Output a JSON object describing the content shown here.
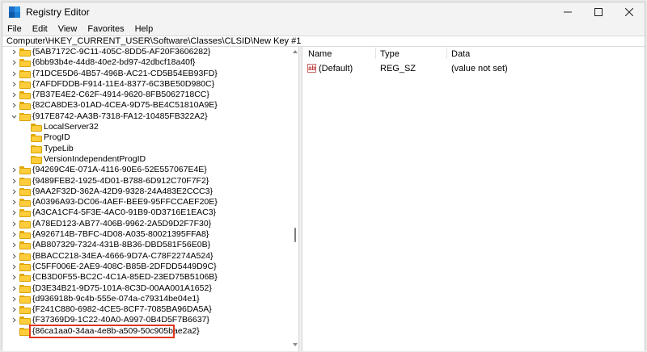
{
  "window": {
    "title": "Registry Editor",
    "controls": [
      "minimize-icon",
      "maximize-icon",
      "close-icon"
    ]
  },
  "menu": [
    "File",
    "Edit",
    "View",
    "Favorites",
    "Help"
  ],
  "address": "Computer\\HKEY_CURRENT_USER\\Software\\Classes\\CLSID\\New Key #1",
  "tree": [
    {
      "label": "{5AB7172C-9C11-405C-8DD5-AF20F3606282}",
      "level": 0,
      "expanded": false
    },
    {
      "label": "{6bb93b4e-44d8-40e2-bd97-42dbcf18a40f}",
      "level": 0,
      "expanded": false
    },
    {
      "label": "{71DCE5D6-4B57-496B-AC21-CD5B54EB93FD}",
      "level": 0,
      "expanded": false
    },
    {
      "label": "{7AFDFDDB-F914-11E4-8377-6C3BE50D980C}",
      "level": 0,
      "expanded": false
    },
    {
      "label": "{7B37E4E2-C62F-4914-9620-8FB5062718CC}",
      "level": 0,
      "expanded": false
    },
    {
      "label": "{82CA8DE3-01AD-4CEA-9D75-BE4C51810A9E}",
      "level": 0,
      "expanded": false
    },
    {
      "label": "{917E8742-AA3B-7318-FA12-10485FB322A2}",
      "level": 0,
      "expanded": true
    },
    {
      "label": "LocalServer32",
      "level": 1,
      "expanded": null
    },
    {
      "label": "ProgID",
      "level": 1,
      "expanded": null
    },
    {
      "label": "TypeLib",
      "level": 1,
      "expanded": null
    },
    {
      "label": "VersionIndependentProgID",
      "level": 1,
      "expanded": null
    },
    {
      "label": "{94269C4E-071A-4116-90E6-52E557067E4E}",
      "level": 0,
      "expanded": false
    },
    {
      "label": "{9489FEB2-1925-4D01-B788-6D912C70F7F2}",
      "level": 0,
      "expanded": false
    },
    {
      "label": "{9AA2F32D-362A-42D9-9328-24A483E2CCC3}",
      "level": 0,
      "expanded": false
    },
    {
      "label": "{A0396A93-DC06-4AEF-BEE9-95FFCCAEF20E}",
      "level": 0,
      "expanded": false
    },
    {
      "label": "{A3CA1CF4-5F3E-4AC0-91B9-0D3716E1EAC3}",
      "level": 0,
      "expanded": false
    },
    {
      "label": "{A78ED123-AB77-406B-9962-2A5D9D2F7F30}",
      "level": 0,
      "expanded": false
    },
    {
      "label": "{A926714B-7BFC-4D08-A035-80021395FFA8}",
      "level": 0,
      "expanded": false
    },
    {
      "label": "{AB807329-7324-431B-8B36-DBD581F56E0B}",
      "level": 0,
      "expanded": false
    },
    {
      "label": "{BBACC218-34EA-4666-9D7A-C78F2274A524}",
      "level": 0,
      "expanded": false
    },
    {
      "label": "{C5FF006E-2AE9-408C-B85B-2DFDD5449D9C}",
      "level": 0,
      "expanded": false
    },
    {
      "label": "{CB3D0F55-BC2C-4C1A-85ED-23ED75B5106B}",
      "level": 0,
      "expanded": false
    },
    {
      "label": "{D3E34B21-9D75-101A-8C3D-00AA001A1652}",
      "level": 0,
      "expanded": false
    },
    {
      "label": "{d936918b-9c4b-555e-074a-c79314be04e1}",
      "level": 0,
      "expanded": false
    },
    {
      "label": "{F241C880-6982-4CE5-8CF7-7085BA96DA5A}",
      "level": 0,
      "expanded": false
    },
    {
      "label": "{F37369D9-1C22-40A0-A997-0B4D5F7B6637}",
      "level": 0,
      "expanded": false
    },
    {
      "label": "{86ca1aa0-34aa-4e8b-a509-50c905bae2a2}",
      "level": 0,
      "expanded": null,
      "highlighted": true
    }
  ],
  "columns": {
    "name": "Name",
    "type": "Type",
    "data": "Data"
  },
  "values": [
    {
      "name": "(Default)",
      "type": "REG_SZ",
      "data": "(value not set)",
      "icon": "string-value-icon"
    }
  ],
  "colors": {
    "highlight": "#e2371f",
    "folder": "#ffcd3c"
  }
}
